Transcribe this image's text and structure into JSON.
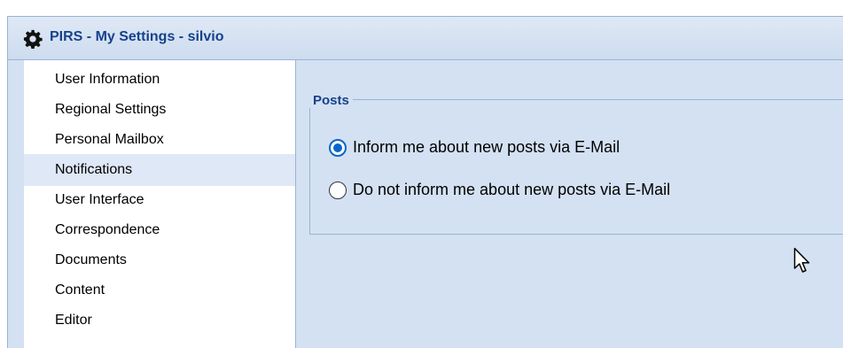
{
  "window": {
    "title": "PIRS - My Settings - silvio",
    "title_icon": "gear-icon"
  },
  "sidebar": {
    "items": [
      {
        "label": "User Information"
      },
      {
        "label": "Regional Settings"
      },
      {
        "label": "Personal Mailbox"
      },
      {
        "label": "Notifications",
        "selected": true
      },
      {
        "label": "User Interface"
      },
      {
        "label": "Correspondence"
      },
      {
        "label": "Documents"
      },
      {
        "label": "Content"
      },
      {
        "label": "Editor"
      }
    ]
  },
  "posts": {
    "legend": "Posts",
    "options": [
      {
        "label": "Inform me about new posts via E-Mail",
        "checked": true
      },
      {
        "label": "Do not inform me about new posts via E-Mail",
        "checked": false
      }
    ]
  },
  "colors": {
    "accent": "#0a66c9",
    "title_text": "#15428b",
    "panel_bg": "#d4e1f2",
    "selected_bg": "#dfe8f6"
  }
}
